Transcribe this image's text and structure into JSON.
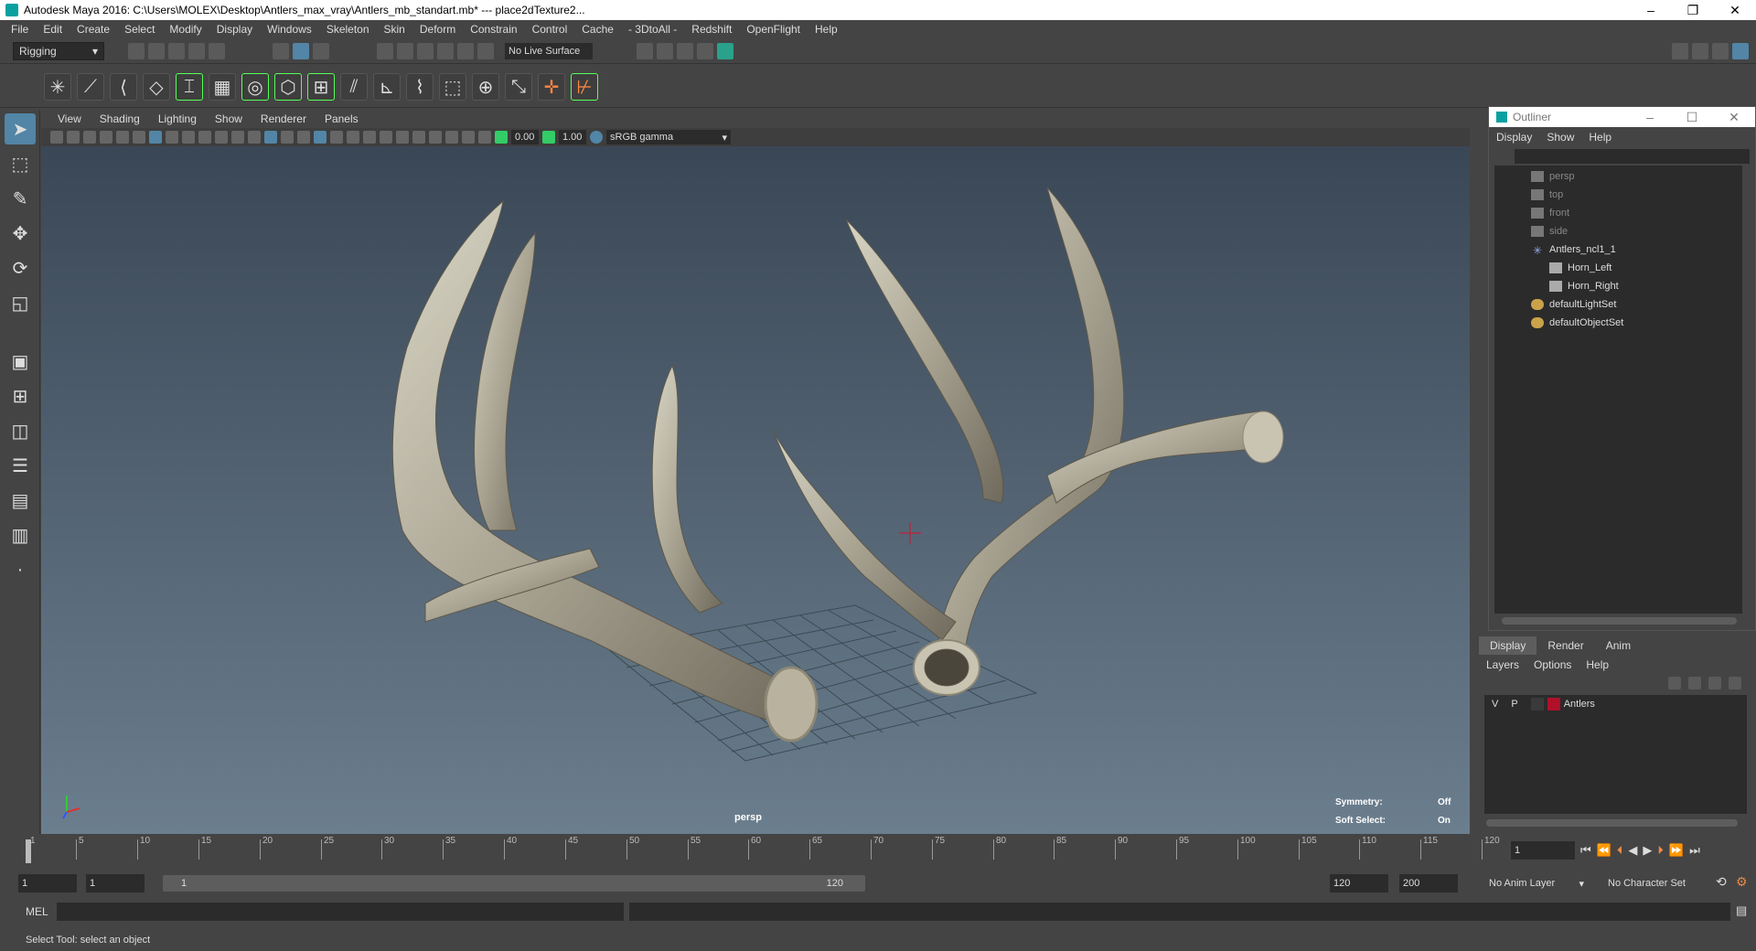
{
  "window": {
    "title": "Autodesk Maya 2016: C:\\Users\\MOLEX\\Desktop\\Antlers_max_vray\\Antlers_mb_standart.mb*   ---   place2dTexture2...",
    "minimize": "–",
    "maximize": "❐",
    "close": "✕"
  },
  "menubar": [
    "File",
    "Edit",
    "Create",
    "Select",
    "Modify",
    "Display",
    "Windows",
    "Skeleton",
    "Skin",
    "Deform",
    "Constrain",
    "Control",
    "Cache",
    "- 3DtoAll -",
    "Redshift",
    "OpenFlight",
    "Help"
  ],
  "toolbar": {
    "mode": "Rigging",
    "live_surface": "No Live Surface"
  },
  "panel": {
    "menus": [
      "View",
      "Shading",
      "Lighting",
      "Show",
      "Renderer",
      "Panels"
    ],
    "field1": "0.00",
    "field2": "1.00",
    "color_space": "sRGB gamma"
  },
  "viewport": {
    "camera": "persp",
    "symmetry_label": "Symmetry:",
    "symmetry_value": "Off",
    "soft_select_label": "Soft Select:",
    "soft_select_value": "On"
  },
  "outliner": {
    "title": "Outliner",
    "menus": [
      "Display",
      "Show",
      "Help"
    ],
    "items": [
      {
        "label": "persp",
        "dim": true
      },
      {
        "label": "top",
        "dim": true
      },
      {
        "label": "front",
        "dim": true
      },
      {
        "label": "side",
        "dim": true
      },
      {
        "label": "Antlers_ncl1_1",
        "dim": false
      },
      {
        "label": "Horn_Left",
        "dim": false
      },
      {
        "label": "Horn_Right",
        "dim": false
      },
      {
        "label": "defaultLightSet",
        "dim": false
      },
      {
        "label": "defaultObjectSet",
        "dim": false
      }
    ]
  },
  "layers": {
    "tabs": [
      "Display",
      "Render",
      "Anim"
    ],
    "menus": [
      "Layers",
      "Options",
      "Help"
    ],
    "layer": {
      "v": "V",
      "p": "P",
      "name": "Antlers",
      "color": "#b0102a"
    }
  },
  "timeline": {
    "ticks": [
      "1",
      "5",
      "10",
      "15",
      "20",
      "25",
      "30",
      "35",
      "40",
      "45",
      "50",
      "55",
      "60",
      "65",
      "70",
      "75",
      "80",
      "85",
      "90",
      "95",
      "100",
      "105",
      "110",
      "115",
      "120"
    ],
    "current": "1"
  },
  "range": {
    "start": "1",
    "inner_start": "1",
    "slider_start": "1",
    "slider_end": "120",
    "end": "120",
    "max": "200",
    "anim_layer": "No Anim Layer",
    "char_set": "No Character Set"
  },
  "cmdline": {
    "label": "MEL"
  },
  "helpline": "Select Tool: select an object"
}
